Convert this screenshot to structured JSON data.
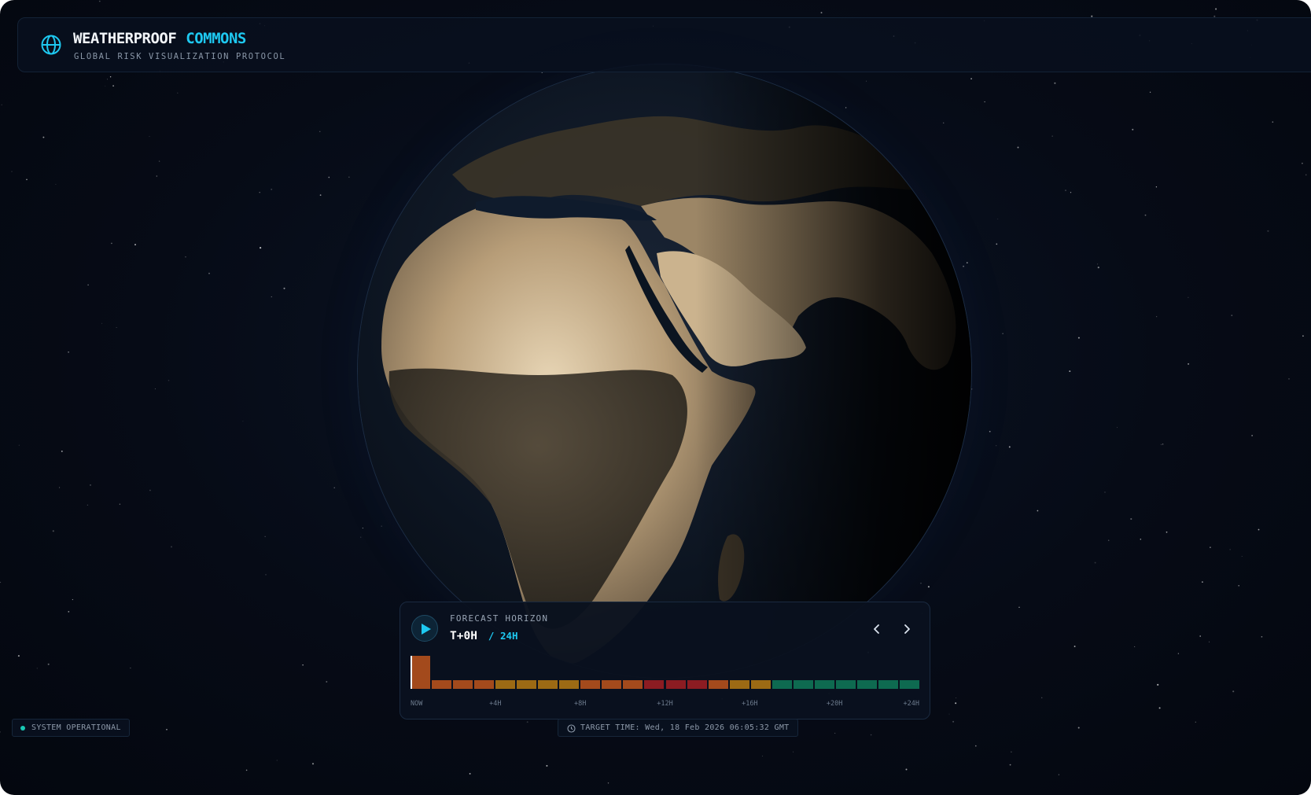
{
  "header": {
    "brand_primary": "WEATHERPROOF",
    "brand_accent": "COMMONS",
    "subtitle": "GLOBAL RISK VISUALIZATION PROTOCOL",
    "icon": "globe-icon"
  },
  "forecast": {
    "label": "FORECAST HORIZON",
    "current": "T+0H",
    "total": "/ 24H",
    "play_icon": "play-icon",
    "prev_icon": "chevron-left-icon",
    "next_icon": "chevron-right-icon",
    "current_index": 0,
    "hour_risk": [
      "orange",
      "orange",
      "orange",
      "orange",
      "amber",
      "amber",
      "amber",
      "amber",
      "orange",
      "orange",
      "orange",
      "red",
      "red",
      "red",
      "orange",
      "amber",
      "amber",
      "green",
      "green",
      "green",
      "green",
      "green",
      "green",
      "green"
    ],
    "risk_colors": {
      "orange": "#a34a1c",
      "amber": "#9c6a14",
      "red": "#8c1c22",
      "green": "#0e6a50"
    },
    "ticks": [
      "NOW",
      "+4H",
      "+8H",
      "+12H",
      "+16H",
      "+20H",
      "+24H"
    ]
  },
  "footer": {
    "status_text": "SYSTEM OPERATIONAL",
    "target_label": "TARGET TIME: Wed, 18 Feb 2026 06:05:32 GMT",
    "clock_icon": "clock-icon"
  },
  "colors": {
    "accent": "#1ec8f0",
    "status_ok": "#19c8b4",
    "background": "#060b16"
  }
}
